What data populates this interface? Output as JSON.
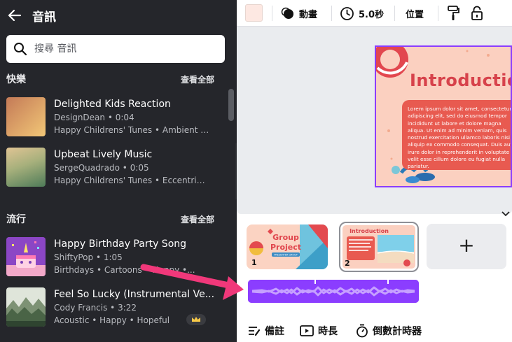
{
  "sidebar": {
    "back_label": "back",
    "title": "音訊",
    "search": {
      "placeholder": "搜尋 音訊",
      "value": ""
    },
    "sections": [
      {
        "title": "快樂",
        "see_all": "查看全部",
        "tracks": [
          {
            "title": "Delighted Kids Reaction",
            "meta": "DesignDean • 0:04",
            "tags": "Happy Childrens' Tunes • Ambient •...",
            "thumb_from": "#c9865e",
            "thumb_to": "#f0c275"
          },
          {
            "title": "Upbeat Lively Music",
            "meta": "SergeQuadrado • 0:05",
            "tags": "Happy Childrens' Tunes • Eccentric •...",
            "thumb_from": "#4f7d5a",
            "thumb_to": "#dcc196"
          }
        ]
      },
      {
        "title": "流行",
        "see_all": "查看全部",
        "tracks": [
          {
            "title": "Happy Birthday Party Song",
            "meta": "ShiftyPop • 1:05",
            "tags": "Birthdays • Cartoons • Happy •...",
            "thumb_from": "#7a39b8",
            "thumb_to": "#f2b5d0",
            "pro": false
          },
          {
            "title": "Feel So Lucky (Instrumental Ve...",
            "meta": "Cody Francis • 3:22",
            "tags": "Acoustic • Happy • Hopeful",
            "thumb_from": "#cfd8c9",
            "thumb_to": "#3f5a3c",
            "pro": true
          }
        ]
      }
    ]
  },
  "editor": {
    "toolbar": {
      "swatch_color": "#fde8e2",
      "animate_label": "動畫",
      "duration_label": "5.0秒",
      "position_label": "位置",
      "paint_icon": "paint-roller-icon",
      "lock_icon": "lock-icon"
    },
    "slide": {
      "heading": "Introduction",
      "body": "Lorem ipsum dolor sit amet, consectetur adipiscing elit, sed do eiusmod tempor incididunt ut labore et dolore magna aliqua. Ut enim ad minim veniam, quis nostrud exercitation ullamco laboris nisi ut aliquip ex commodo consequat. Duis aute irure dolor in reprehenderit in voluptate velit esse cillum dolore eu fugiat nulla pariatur.",
      "accent_color": "#8b3dff"
    },
    "pages": [
      {
        "number": "1",
        "title_line1": "Group",
        "title_line2": "Project",
        "ribbon": "PRESENTER GROUP"
      },
      {
        "number": "2",
        "title": "Introduction"
      }
    ],
    "add_page_label": "+",
    "audio_track_color": "#8b3dff",
    "footer": {
      "notes_label": "備註",
      "duration_label": "時長",
      "timer_label": "倒數計時器"
    }
  },
  "colors": {
    "sidebar_bg": "#25262b",
    "pointer_arrow": "#f0387a"
  }
}
